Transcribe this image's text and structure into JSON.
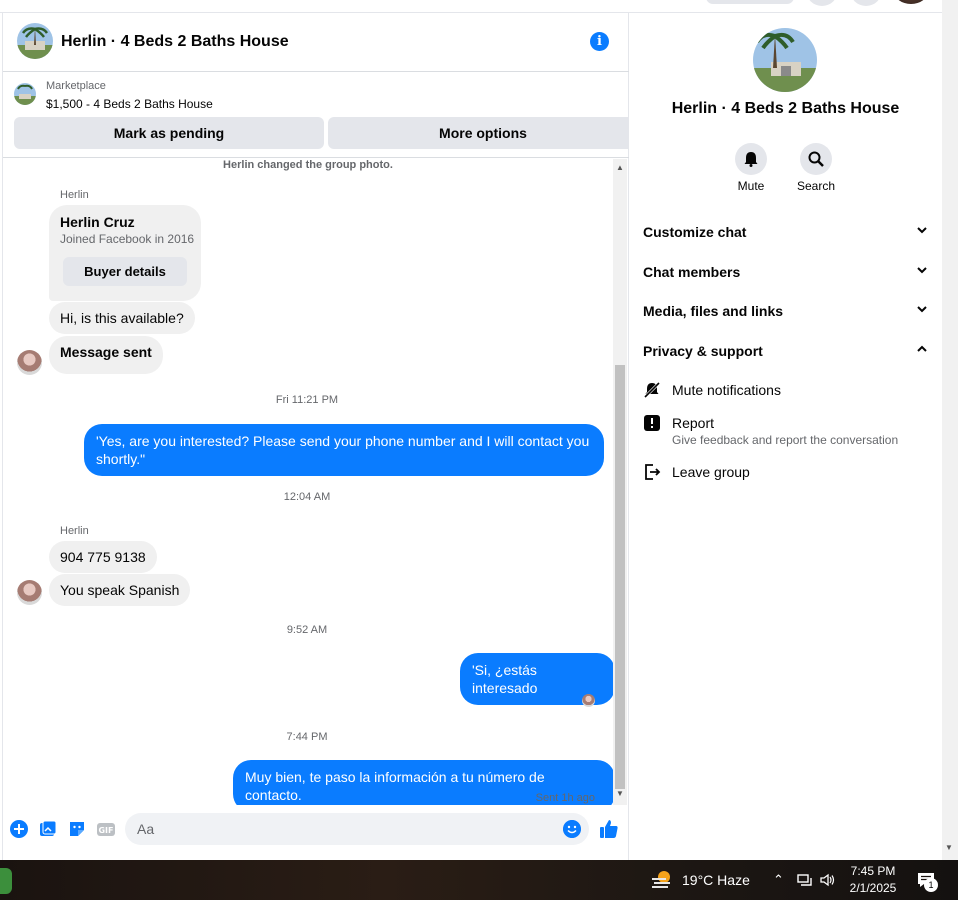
{
  "chat": {
    "title": "Herlin · 4 Beds 2 Baths House",
    "marketplace_label": "Marketplace",
    "listing": "$1,500 - 4 Beds 2 Baths House",
    "mark_pending_label": "Mark as pending",
    "more_options_label": "More options",
    "system_note": "Herlin changed the group photo.",
    "messages": {
      "sender_1": "Herlin",
      "card_name": "Herlin Cruz",
      "card_sub": "Joined Facebook in 2016",
      "card_button": "Buyer details",
      "msg_1": "Hi, is this available?",
      "msg_2": "Message sent",
      "ts_1": "Fri 11:21 PM",
      "out_1": "'Yes, are you interested? Please send your phone number and I will contact you shortly.\"",
      "ts_2": "12:04 AM",
      "sender_2": "Herlin",
      "msg_3": "904 775 9138",
      "msg_4": "You speak Spanish",
      "ts_3": "9:52 AM",
      "out_2": "'Si, ¿estás interesado",
      "ts_4": "7:44 PM",
      "out_3": "Muy bien, te paso la información a tu número de contacto.",
      "sent_status": "Sent 1h ago"
    },
    "composer_placeholder": "Aa"
  },
  "info_panel": {
    "title": "Herlin · 4 Beds 2 Baths House",
    "mute_label": "Mute",
    "search_label": "Search",
    "sections": {
      "customize": "Customize chat",
      "members": "Chat members",
      "media": "Media, files and links",
      "privacy": "Privacy & support"
    },
    "options": {
      "mute_notifications": "Mute notifications",
      "report": "Report",
      "report_sub": "Give feedback and report the conversation",
      "leave": "Leave group"
    }
  },
  "taskbar": {
    "weather": "19°C  Haze",
    "time": "7:45 PM",
    "date": "2/1/2025",
    "notification_count": "1"
  },
  "colors": {
    "messenger_blue": "#0a7cff",
    "bubble_gray": "#f0f0f0",
    "button_gray": "#e4e6eb"
  },
  "icons": [
    "info-icon",
    "bell-icon",
    "search-icon",
    "chevron-down-icon",
    "chevron-up-icon",
    "bell-off-icon",
    "report-icon",
    "leave-icon",
    "plus-icon",
    "photo-icon",
    "sticker-icon",
    "gif-icon",
    "emoji-icon",
    "like-icon"
  ]
}
